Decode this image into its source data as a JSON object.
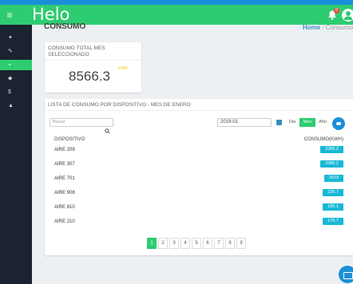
{
  "app": {
    "logo_text": "Helo",
    "accent": "#2ecc71",
    "sidebar_bg": "#1c2330",
    "brand_blue": "#1a8fd8"
  },
  "header": {
    "title": "CONSUMO",
    "breadcrumb": [
      "Home",
      "Consumo"
    ]
  },
  "kpi": {
    "label": "CONSUMO TOTAL MES SELECCIONADO",
    "value": "8566.3",
    "unit": "KWH"
  },
  "table": {
    "title": "LISTA DE CONSUMO POR DISPOSITIVO - MES DE ENERO",
    "search_placeholder": "Buscar",
    "date_value": "2019-01",
    "period_options": [
      "Dia",
      "Mes",
      "Año"
    ],
    "period_selected": "Mes",
    "columns": [
      "DISPOSITIVO",
      "CONSUMO(KWH)"
    ],
    "rows": [
      {
        "device": "AIRE 209",
        "value": "2385.2"
      },
      {
        "device": "AIRE 307",
        "value": "2385.2"
      },
      {
        "device": "AIRE 701",
        "value": "3019"
      },
      {
        "device": "AIRE 908",
        "value": "235.7"
      },
      {
        "device": "AIRE 810",
        "value": "185.1"
      },
      {
        "device": "AIRE 210",
        "value": "175.7"
      }
    ],
    "pagination": [
      "1",
      "2",
      "3",
      "4",
      "5",
      "6",
      "7",
      "8",
      "9"
    ],
    "current_page": "1"
  },
  "icons": {
    "menu": "hamburger-icon",
    "notifications": "bell-icon",
    "user": "user-icon",
    "search": "search-icon",
    "calendar": "calendar-icon",
    "refresh": "refresh-icon",
    "mail": "mail-icon"
  },
  "notifications_count": "0"
}
